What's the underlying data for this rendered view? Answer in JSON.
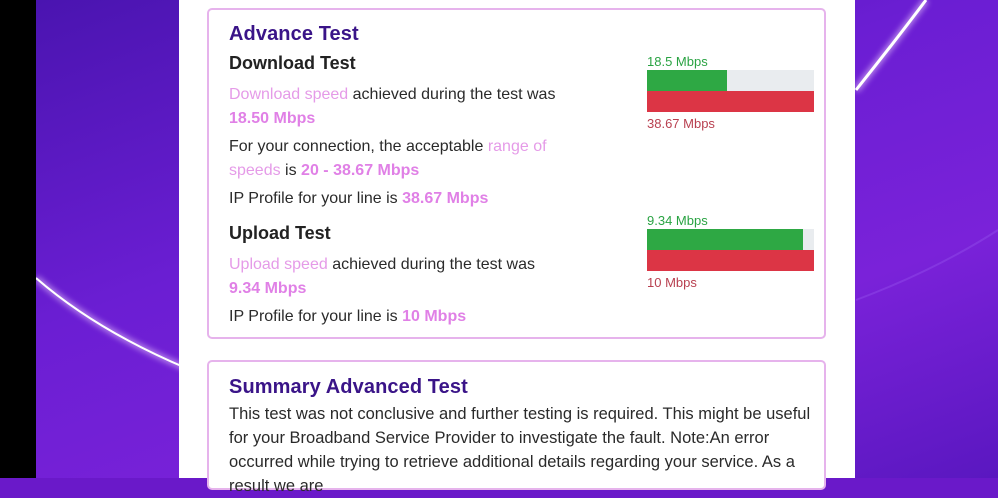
{
  "advance": {
    "title": "Advance Test",
    "download": {
      "heading": "Download Test",
      "speed_link": "Download speed",
      "achieved_text": " achieved during the test was ",
      "speed_value": "18.50 Mbps",
      "range_prefix": "For your connection, the acceptable ",
      "range_link": "range of speeds",
      "range_is": " is ",
      "range_value": "20 - 38.67 Mbps",
      "ip_prefix": "IP Profile for your line is ",
      "ip_value": "38.67 Mbps",
      "bar_measured_label": "18.5 Mbps",
      "bar_measured_fraction": 0.478,
      "bar_profile_label": "38.67 Mbps"
    },
    "upload": {
      "heading": "Upload Test",
      "speed_link": "Upload speed",
      "achieved_text": " achieved during the test was ",
      "speed_value": "9.34 Mbps",
      "ip_prefix": "IP Profile for your line is ",
      "ip_value": "10 Mbps",
      "bar_measured_label": "9.34 Mbps",
      "bar_measured_fraction": 0.934,
      "bar_profile_label": "10 Mbps"
    }
  },
  "summary": {
    "title": "Summary Advanced Test",
    "text": "This test was not conclusive and further testing is required. This might be useful for your Broadband Service Provider to investigate the fault. Note:An error occurred while trying to retrieve additional details regarding your service. As a result we are"
  },
  "colors": {
    "accent": "#3a1488",
    "highlight": "#e59be8",
    "green": "#2ea844",
    "red": "#dc3545",
    "background": "#6b1ed3"
  }
}
